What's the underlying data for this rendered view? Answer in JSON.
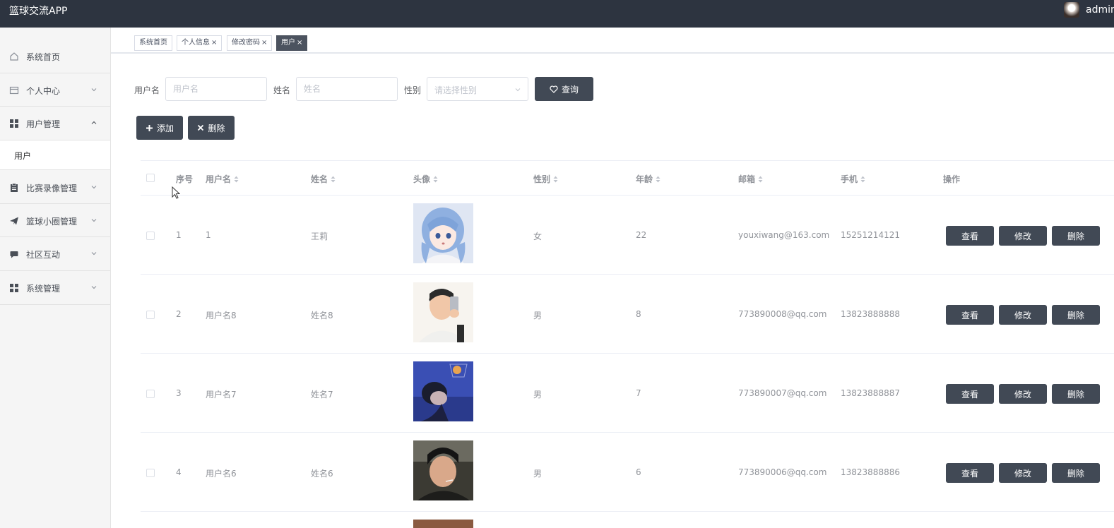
{
  "app": {
    "title": "篮球交流APP",
    "user": "admin"
  },
  "sidebar": {
    "items": [
      {
        "label": "系统首页",
        "icon": "home-icon",
        "expandable": false
      },
      {
        "label": "个人中心",
        "icon": "card-icon",
        "expandable": true,
        "expanded": false
      },
      {
        "label": "用户管理",
        "icon": "grid-icon",
        "expandable": true,
        "expanded": true
      },
      {
        "label": "比赛录像管理",
        "icon": "clipboard-icon",
        "expandable": true,
        "expanded": false
      },
      {
        "label": "篮球小圈管理",
        "icon": "paper-plane-icon",
        "expandable": true,
        "expanded": false
      },
      {
        "label": "社区互动",
        "icon": "chat-icon",
        "expandable": true,
        "expanded": false
      },
      {
        "label": "系统管理",
        "icon": "grid-icon",
        "expandable": true,
        "expanded": false
      }
    ],
    "submenu": {
      "label": "用户"
    }
  },
  "tabs": [
    {
      "label": "系统首页",
      "closable": false,
      "active": false
    },
    {
      "label": "个人信息",
      "closable": true,
      "active": false
    },
    {
      "label": "修改密码",
      "closable": true,
      "active": false
    },
    {
      "label": "用户",
      "closable": true,
      "active": true
    }
  ],
  "search": {
    "username_label": "用户名",
    "username_placeholder": "用户名",
    "name_label": "姓名",
    "name_placeholder": "姓名",
    "gender_label": "性别",
    "gender_placeholder": "请选择性别",
    "query_button": "查询"
  },
  "actions": {
    "add_button": "添加",
    "delete_button": "删除"
  },
  "table": {
    "columns": [
      "序号",
      "用户名",
      "姓名",
      "头像",
      "性别",
      "年龄",
      "邮箱",
      "手机",
      "操作"
    ],
    "rows": [
      {
        "index": "1",
        "username": "1",
        "name": "王莉",
        "gender": "女",
        "age": "22",
        "email": "youxiwang@163.com",
        "phone": "15251214121"
      },
      {
        "index": "2",
        "username": "用户名8",
        "name": "姓名8",
        "gender": "男",
        "age": "8",
        "email": "773890008@qq.com",
        "phone": "13823888888"
      },
      {
        "index": "3",
        "username": "用户名7",
        "name": "姓名7",
        "gender": "男",
        "age": "7",
        "email": "773890007@qq.com",
        "phone": "13823888887"
      },
      {
        "index": "4",
        "username": "用户名6",
        "name": "姓名6",
        "gender": "男",
        "age": "6",
        "email": "773890006@qq.com",
        "phone": "13823888886"
      }
    ],
    "row_actions": {
      "view": "查看",
      "edit": "修改",
      "delete": "删除"
    }
  },
  "colors": {
    "header": "#2d3440",
    "button": "#414955",
    "sidebar": "#f5f5f5"
  }
}
